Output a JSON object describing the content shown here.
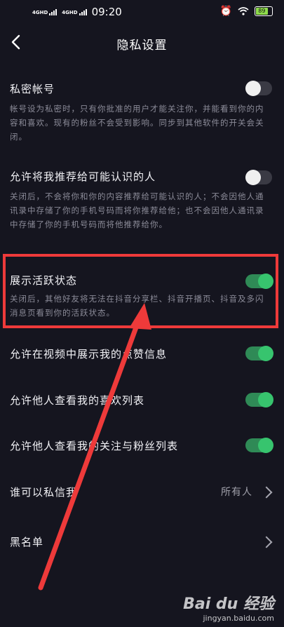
{
  "status": {
    "net1": "4GHD",
    "net2": "4GHD",
    "time": "09:20",
    "battery": "89"
  },
  "nav": {
    "title": "隐私设置"
  },
  "settings": [
    {
      "title": "私密帐号",
      "desc": "帐号设为私密时，只有你批准的用户才能关注你，并能看到你的内容和喜欢。现有的粉丝不会受到影响。同步到其他软件的开关会关闭。",
      "toggle": "off"
    },
    {
      "title": "允许将我推荐给可能认识的人",
      "desc": "关闭后，不会将你和你的内容推荐给可能认识的人；不会因他人通讯录中存储了你的手机号码而将你推荐给他；也不会因他人通讯录中存储了你的手机号码而将他推荐给你。",
      "toggle": "off"
    },
    {
      "title": "展示活跃状态",
      "desc": "关闭后，其他好友将无法在抖音分享栏、抖音开播页、抖音及多闪消息页看到你的活跃状态。",
      "toggle": "on"
    },
    {
      "title": "允许在视频中展示我的点赞信息",
      "toggle": "on"
    },
    {
      "title": "允许他人查看我的喜欢列表",
      "toggle": "on"
    },
    {
      "title": "允许他人查看我的关注与粉丝列表",
      "toggle": "on"
    },
    {
      "title": "谁可以私信我",
      "value": "所有人"
    },
    {
      "title": "黑名单"
    }
  ],
  "watermark": {
    "logo": "Bai du 经验",
    "url": "jingyan.baidu.com"
  },
  "colors": {
    "background": "#15151f",
    "toggle_on": "#37c46e",
    "annotation": "#ee3a3a"
  }
}
